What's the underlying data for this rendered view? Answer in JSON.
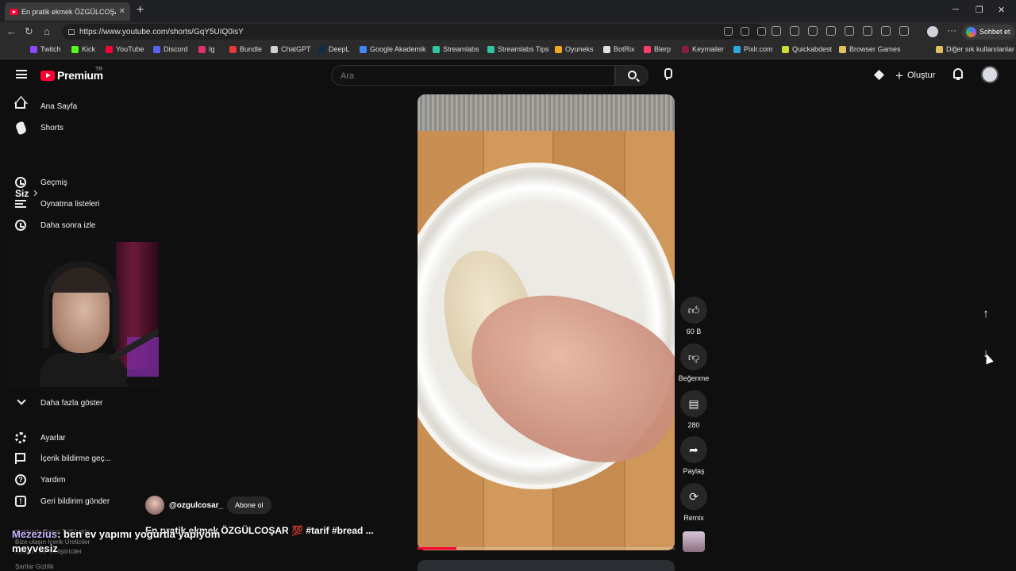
{
  "browser": {
    "tab_title": "En pratik ekmek ÖZGÜLCOŞAR",
    "url": "https://www.youtube.com/shorts/GqY5UIQ0isY",
    "copilot_label": "Sohbet et",
    "bookmarks": [
      {
        "label": "Twitch",
        "color": "#9146ff"
      },
      {
        "label": "Kick",
        "color": "#53fc18"
      },
      {
        "label": "YouTube",
        "color": "#ff0033"
      },
      {
        "label": "Discord",
        "color": "#5865f2"
      },
      {
        "label": "Ig",
        "color": "#e1306c"
      },
      {
        "label": "Bundle",
        "color": "#e53935"
      },
      {
        "label": "ChatGPT",
        "color": "#cfcfcf"
      },
      {
        "label": "DeepL",
        "color": "#0f2b46"
      },
      {
        "label": "Google Akademik",
        "color": "#4285f4"
      },
      {
        "label": "Streamlabs",
        "color": "#31c3a2"
      },
      {
        "label": "Streamlabs Tips",
        "color": "#31c3a2"
      },
      {
        "label": "Oyuneks",
        "color": "#f5a623"
      },
      {
        "label": "BotRix",
        "color": "#e0e0e0"
      },
      {
        "label": "Blerp",
        "color": "#ff3b6b"
      },
      {
        "label": "Keymailer",
        "color": "#8b1e3f"
      },
      {
        "label": "Pixlr.com",
        "color": "#2aa9e0"
      },
      {
        "label": "Quickabdest",
        "color": "#cddc39"
      },
      {
        "label": "Browser Games",
        "color": "#e0c060"
      },
      {
        "label": "Diğer sık kullanılanlar",
        "color": "#e0c060"
      }
    ]
  },
  "youtube": {
    "logo": "Premium",
    "region": "TR",
    "search_placeholder": "Ara",
    "create_label": "Oluştur",
    "sidebar": {
      "home": "Ana Sayfa",
      "shorts": "Shorts",
      "you": "Siz",
      "history": "Geçmiş",
      "playlists": "Oynatma listeleri",
      "watch_later": "Daha sonra izle",
      "show_more": "Daha fazla göster",
      "settings": "Ayarlar",
      "report_history": "İçerik bildirme geç...",
      "help": "Yardım",
      "feedback": "Geri bildirim gönder",
      "footer_1": "Hakkında  Basın  Telif hakkı",
      "footer_2": "Bize ulaşın  İçerik Üreticiler",
      "footer_3": "Reklam ver  Geliştiriciler",
      "footer_4": "Şartlar  Gizlilik"
    },
    "short": {
      "channel": "@ozgulcosar_",
      "subscribe": "Abone ol",
      "title": "En pratik ekmek ÖZGÜLCOŞAR 💯 #tarif #bread ...",
      "progress": 0.15,
      "likes": "60 B",
      "dislike_label": "Beğenme",
      "comments": "280",
      "share_label": "Paylaş",
      "remix_label": "Remix"
    }
  },
  "chat_overlay": {
    "user": "Mezezius",
    "message": ": ben ev yapımı yoğurtla yapıyom",
    "message_2": "meyvesiz"
  }
}
